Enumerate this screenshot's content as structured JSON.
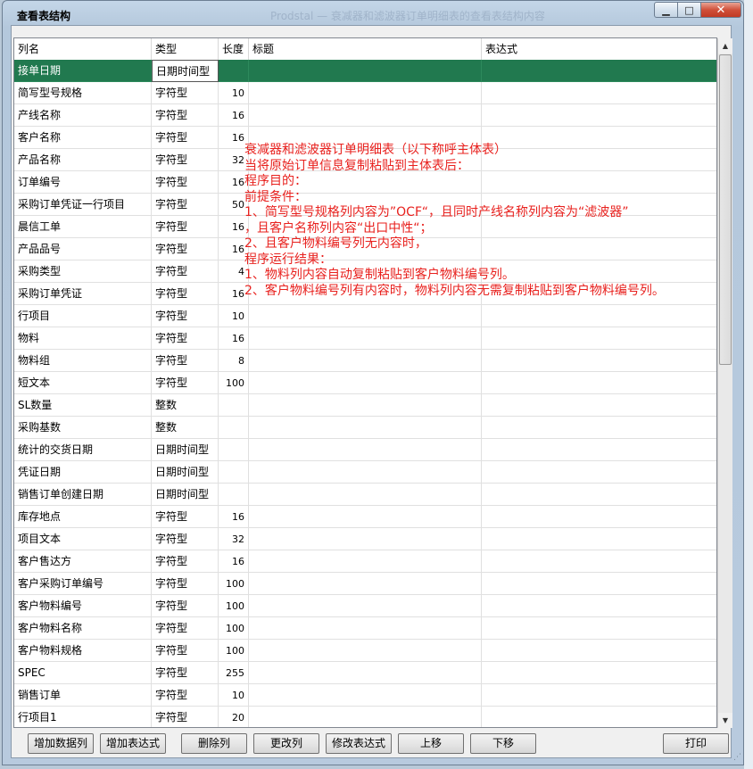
{
  "window": {
    "title": "查看表结构",
    "ghost_title": "Prodstal — 衰减器和滤波器订单明细表的查看表结构内容"
  },
  "grid": {
    "columns": [
      "列名",
      "类型",
      "长度",
      "标题",
      "表达式"
    ],
    "rows": [
      {
        "name": "接单日期",
        "type": "日期时间型",
        "length": "",
        "title": "",
        "expr": ""
      },
      {
        "name": "简写型号规格",
        "type": "字符型",
        "length": "10",
        "title": "",
        "expr": ""
      },
      {
        "name": "产线名称",
        "type": "字符型",
        "length": "16",
        "title": "",
        "expr": ""
      },
      {
        "name": "客户名称",
        "type": "字符型",
        "length": "16",
        "title": "",
        "expr": ""
      },
      {
        "name": "产品名称",
        "type": "字符型",
        "length": "32",
        "title": "",
        "expr": ""
      },
      {
        "name": "订单编号",
        "type": "字符型",
        "length": "16",
        "title": "",
        "expr": ""
      },
      {
        "name": "采购订单凭证一行项目",
        "type": "字符型",
        "length": "50",
        "title": "",
        "expr": ""
      },
      {
        "name": "晨信工单",
        "type": "字符型",
        "length": "16",
        "title": "",
        "expr": ""
      },
      {
        "name": "产品品号",
        "type": "字符型",
        "length": "16",
        "title": "",
        "expr": ""
      },
      {
        "name": "采购类型",
        "type": "字符型",
        "length": "4",
        "title": "",
        "expr": ""
      },
      {
        "name": "采购订单凭证",
        "type": "字符型",
        "length": "16",
        "title": "",
        "expr": ""
      },
      {
        "name": "行项目",
        "type": "字符型",
        "length": "10",
        "title": "",
        "expr": ""
      },
      {
        "name": "物料",
        "type": "字符型",
        "length": "16",
        "title": "",
        "expr": ""
      },
      {
        "name": "物料组",
        "type": "字符型",
        "length": "8",
        "title": "",
        "expr": ""
      },
      {
        "name": "短文本",
        "type": "字符型",
        "length": "100",
        "title": "",
        "expr": ""
      },
      {
        "name": "SL数量",
        "type": "整数",
        "length": "",
        "title": "",
        "expr": ""
      },
      {
        "name": "采购基数",
        "type": "整数",
        "length": "",
        "title": "",
        "expr": ""
      },
      {
        "name": "统计的交货日期",
        "type": "日期时间型",
        "length": "",
        "title": "",
        "expr": ""
      },
      {
        "name": "凭证日期",
        "type": "日期时间型",
        "length": "",
        "title": "",
        "expr": ""
      },
      {
        "name": "销售订单创建日期",
        "type": "日期时间型",
        "length": "",
        "title": "",
        "expr": ""
      },
      {
        "name": "库存地点",
        "type": "字符型",
        "length": "16",
        "title": "",
        "expr": ""
      },
      {
        "name": "项目文本",
        "type": "字符型",
        "length": "32",
        "title": "",
        "expr": ""
      },
      {
        "name": "客户售达方",
        "type": "字符型",
        "length": "16",
        "title": "",
        "expr": ""
      },
      {
        "name": "客户采购订单编号",
        "type": "字符型",
        "length": "100",
        "title": "",
        "expr": ""
      },
      {
        "name": "客户物料编号",
        "type": "字符型",
        "length": "100",
        "title": "",
        "expr": ""
      },
      {
        "name": "客户物料名称",
        "type": "字符型",
        "length": "100",
        "title": "",
        "expr": ""
      },
      {
        "name": "客户物料规格",
        "type": "字符型",
        "length": "100",
        "title": "",
        "expr": ""
      },
      {
        "name": "SPEC",
        "type": "字符型",
        "length": "255",
        "title": "",
        "expr": ""
      },
      {
        "name": "销售订单",
        "type": "字符型",
        "length": "10",
        "title": "",
        "expr": ""
      },
      {
        "name": "行项目1",
        "type": "字符型",
        "length": "20",
        "title": "",
        "expr": ""
      }
    ]
  },
  "annotation": [
    "衰减器和滤波器订单明细表（以下称呼主体表）",
    "当将原始订单信息复制粘贴到主体表后：",
    "程序目的：",
    "前提条件：",
    "1、简写型号规格列内容为”OCF“，且同时产线名称列内容为“滤波器”",
    "，且客户名称列内容“出口中性“；",
    "2、且客户物料编号列无内容时，",
    "程序运行结果：",
    "1、物料列内容自动复制粘贴到客户物料编号列。",
    "2、客户物料编号列有内容时，物料列内容无需复制粘贴到客户物料编号列。"
  ],
  "buttons": {
    "add_data_column": "增加数据列",
    "add_expression": "增加表达式",
    "delete_column": "删除列",
    "change_column": "更改列",
    "modify_expression": "修改表达式",
    "move_up": "上移",
    "move_down": "下移",
    "print": "打印"
  },
  "colors": {
    "selected_row": "#21794f",
    "annotation_text": "#e8211e"
  }
}
